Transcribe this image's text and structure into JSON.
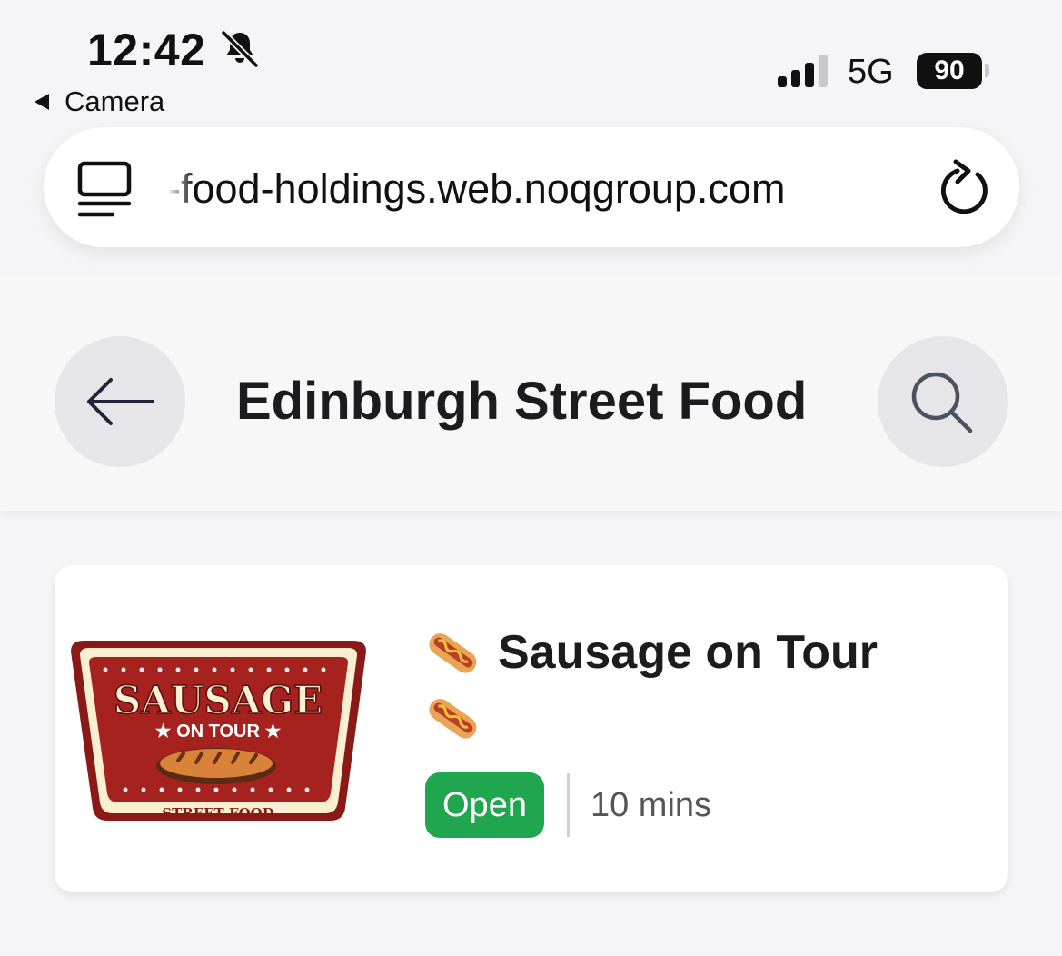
{
  "status_bar": {
    "time": "12:42",
    "back_app": "Camera",
    "network": "5G",
    "battery": "90"
  },
  "browser": {
    "url": "-food-holdings.web.noqgroup.com"
  },
  "header": {
    "title": "Edinburgh Street Food"
  },
  "vendors": [
    {
      "name": "Sausage on Tour",
      "status": "Open",
      "wait_time": "10 mins",
      "logo": {
        "line1": "SAUSAGE",
        "line2": "★ ON TOUR ★",
        "line3": "STREET FOOD"
      }
    }
  ],
  "colors": {
    "open_badge": "#1fa64f",
    "logo_red": "#a5221f",
    "logo_cream": "#fbefd2"
  },
  "icons": {
    "notification": "bell-slash-icon",
    "signal": "signal-bars-icon",
    "reader": "reader-mode-icon",
    "reload": "reload-icon",
    "back": "arrow-left-icon",
    "search": "search-icon",
    "vendor_emoji": "hotdog-icon"
  }
}
